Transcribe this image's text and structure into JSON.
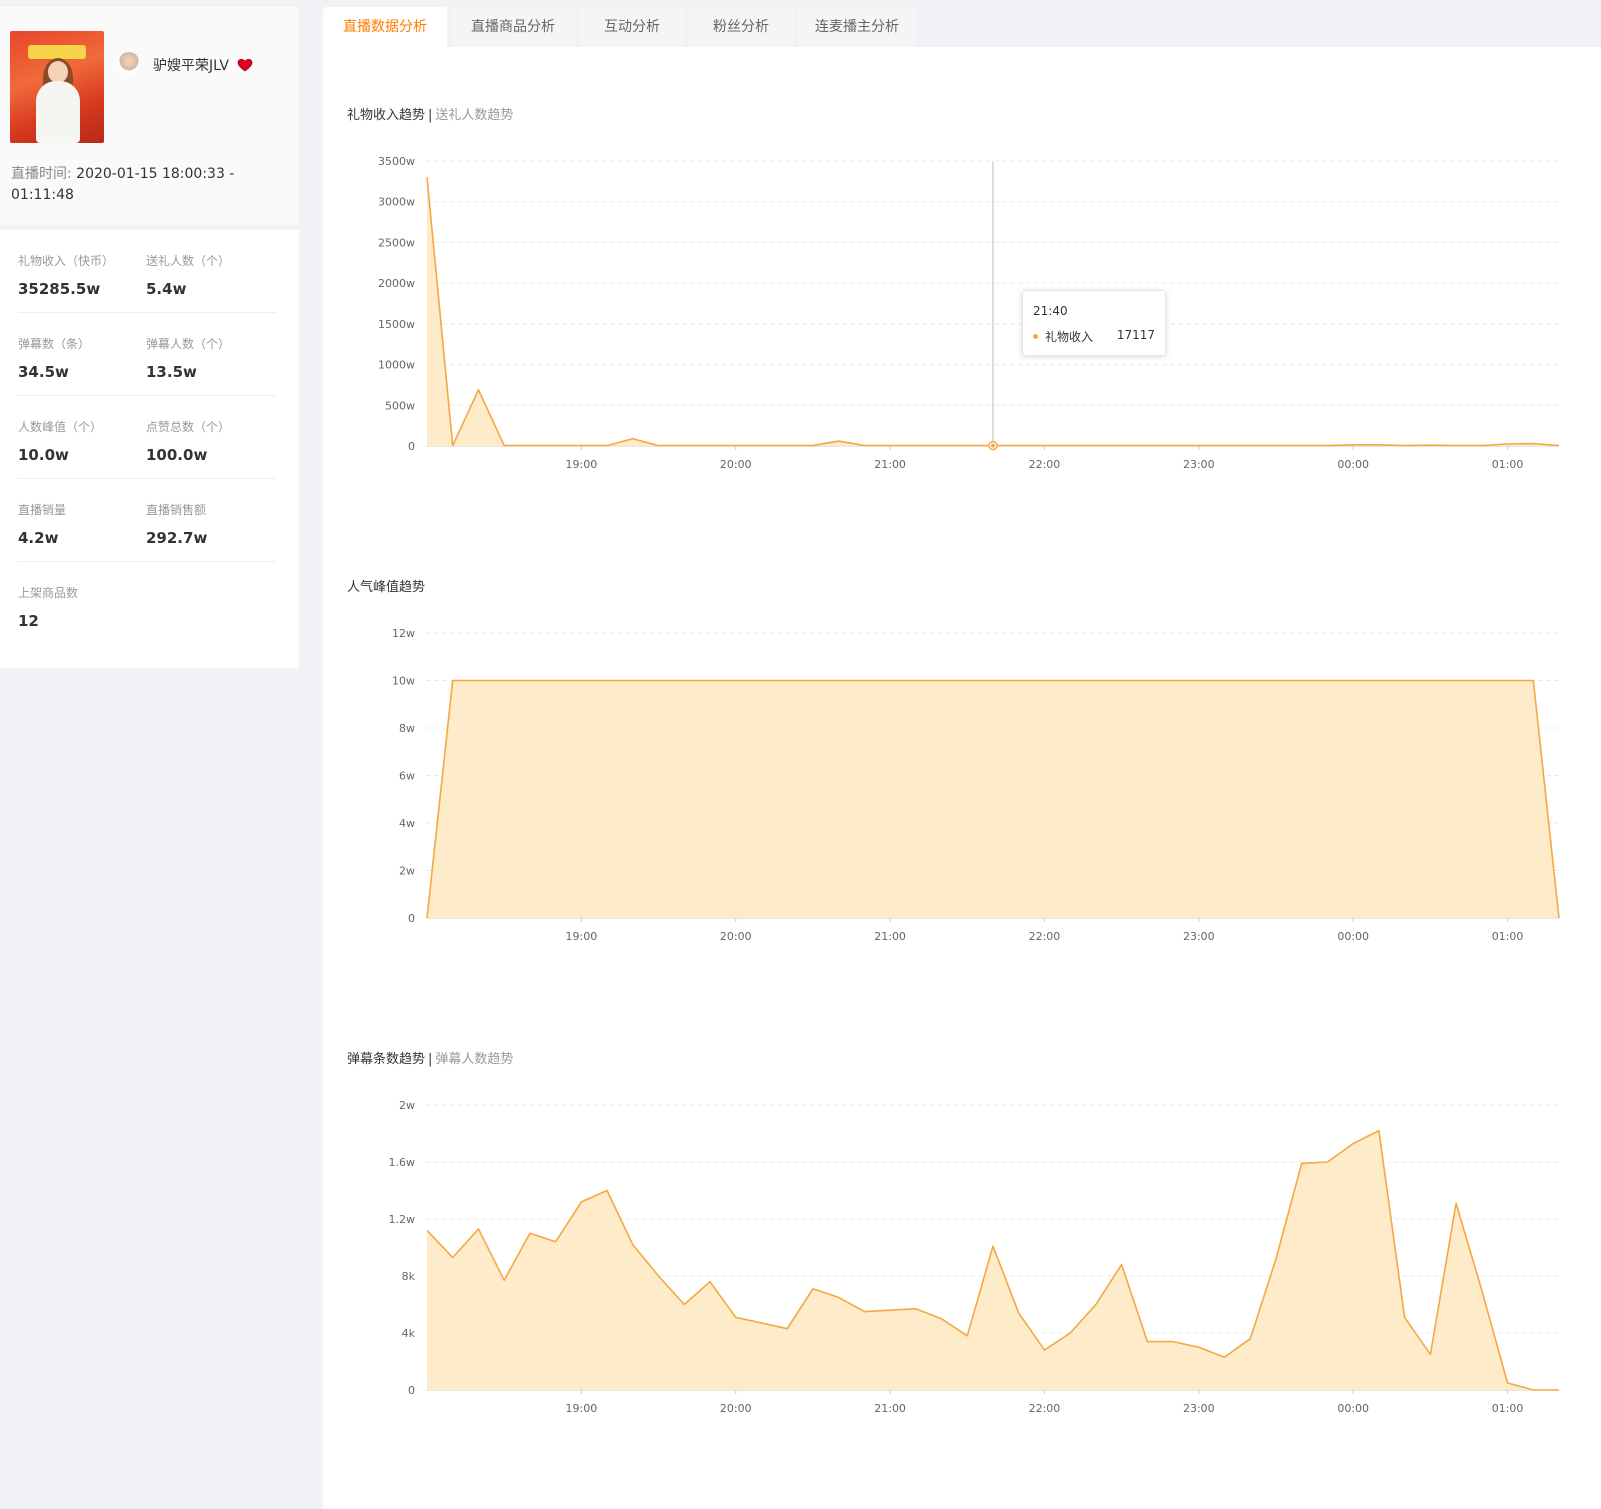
{
  "profile": {
    "anchor_name": "驴嫂平荣JLV",
    "live_time_label": "直播时间:",
    "live_time_value": "2020-01-15 18:00:33 - 01:11:48"
  },
  "stats": [
    [
      {
        "label": "礼物收入（快币）",
        "value": "35285.5w"
      },
      {
        "label": "送礼人数（个）",
        "value": "5.4w"
      }
    ],
    [
      {
        "label": "弹幕数（条）",
        "value": "34.5w"
      },
      {
        "label": "弹幕人数（个）",
        "value": "13.5w"
      }
    ],
    [
      {
        "label": "人数峰值（个）",
        "value": "10.0w"
      },
      {
        "label": "点赞总数（个）",
        "value": "100.0w"
      }
    ],
    [
      {
        "label": "直播销量",
        "value": "4.2w"
      },
      {
        "label": "直播销售额",
        "value": "292.7w"
      }
    ],
    [
      {
        "label": "上架商品数",
        "value": "12"
      }
    ]
  ],
  "tabs": [
    {
      "label": "直播数据分析",
      "active": true
    },
    {
      "label": "直播商品分析",
      "active": false
    },
    {
      "label": "互动分析",
      "active": false
    },
    {
      "label": "粉丝分析",
      "active": false
    },
    {
      "label": "连麦播主分析",
      "active": false
    }
  ],
  "colors": {
    "accent": "#ff7d00",
    "line": "#f5a742",
    "area": "#fdebc9"
  },
  "charts": [
    {
      "title": "礼物收入趋势",
      "alt_title": "送礼人数趋势"
    },
    {
      "title": "人气峰值趋势",
      "alt_title": ""
    },
    {
      "title": "弹幕条数趋势",
      "alt_title": "弹幕人数趋势"
    }
  ],
  "tooltip": {
    "time": "21:40",
    "series": "礼物收入",
    "value": "17117"
  },
  "chart_data": [
    {
      "type": "area",
      "title": "礼物收入趋势",
      "x_ticks": [
        "19:00",
        "20:00",
        "21:00",
        "22:00",
        "23:00",
        "00:00",
        "01:00"
      ],
      "y_ticks": [
        "0",
        "500w",
        "1000w",
        "1500w",
        "2000w",
        "2500w",
        "3000w",
        "3500w"
      ],
      "ylim": [
        0,
        3500
      ],
      "unit": "w",
      "series": [
        {
          "name": "礼物收入",
          "values": [
            3300,
            5,
            690,
            5,
            5,
            5,
            5,
            5,
            90,
            5,
            5,
            5,
            5,
            5,
            5,
            5,
            60,
            5,
            5,
            5,
            5,
            5,
            5,
            5,
            5,
            5,
            5,
            5,
            5,
            5,
            5,
            5,
            5,
            5,
            5,
            5,
            15,
            15,
            5,
            10,
            5,
            5,
            25,
            30,
            5
          ]
        }
      ],
      "crosshair_index": 22
    },
    {
      "type": "area",
      "title": "人气峰值趋势",
      "x_ticks": [
        "19:00",
        "20:00",
        "21:00",
        "22:00",
        "23:00",
        "00:00",
        "01:00"
      ],
      "y_ticks": [
        "0",
        "2w",
        "4w",
        "6w",
        "8w",
        "10w",
        "12w"
      ],
      "ylim": [
        0,
        12
      ],
      "unit": "w",
      "series": [
        {
          "name": "人气峰值",
          "values": [
            0,
            10,
            10,
            10,
            10,
            10,
            10,
            10,
            10,
            10,
            10,
            10,
            10,
            10,
            10,
            10,
            10,
            10,
            10,
            10,
            10,
            10,
            10,
            10,
            10,
            10,
            10,
            10,
            10,
            10,
            10,
            10,
            10,
            10,
            10,
            10,
            10,
            10,
            10,
            10,
            10,
            10,
            10,
            10,
            0
          ]
        }
      ]
    },
    {
      "type": "area",
      "title": "弹幕条数趋势",
      "x_ticks": [
        "19:00",
        "20:00",
        "21:00",
        "22:00",
        "23:00",
        "00:00",
        "01:00"
      ],
      "y_ticks": [
        "0",
        "4k",
        "8k",
        "1.2w",
        "1.6w",
        "2w"
      ],
      "ylim": [
        0,
        20000
      ],
      "series": [
        {
          "name": "弹幕条数",
          "values": [
            11200,
            9300,
            11300,
            7700,
            11000,
            10400,
            13200,
            14000,
            10200,
            8000,
            6000,
            7600,
            5100,
            4700,
            4300,
            7100,
            6500,
            5500,
            5600,
            5700,
            5000,
            3800,
            10100,
            5400,
            2800,
            4000,
            6000,
            8800,
            3400,
            3400,
            3000,
            2300,
            3600,
            9200,
            15900,
            16000,
            17300,
            18200,
            5100,
            2500,
            13100,
            7000,
            500,
            0,
            0
          ]
        }
      ]
    }
  ]
}
